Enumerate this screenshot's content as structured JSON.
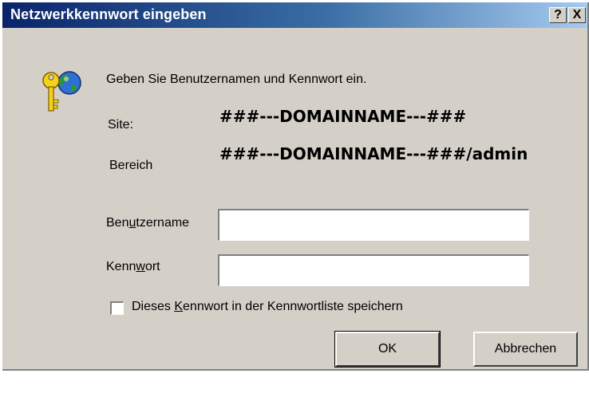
{
  "window": {
    "title": "Netzwerkkennwort eingeben",
    "help_button": "?",
    "close_button": "X"
  },
  "icon": "key-globe-icon",
  "prompt": "Geben Sie Benutzernamen und Kennwort ein.",
  "site": {
    "label": "Site:",
    "value": "###---DOMAINNAME---###"
  },
  "bereich": {
    "label": "Bereich",
    "value": "###---DOMAINNAME---###/admin"
  },
  "username": {
    "label_pre": "Ben",
    "label_key": "u",
    "label_post": "tzername",
    "value": ""
  },
  "password": {
    "label_pre": "Kenn",
    "label_key": "w",
    "label_post": "ort",
    "value": ""
  },
  "save_password": {
    "label_pre": "Dieses ",
    "label_key": "K",
    "label_post": "ennwort in der Kennwortliste speichern",
    "checked": false
  },
  "buttons": {
    "ok": "OK",
    "cancel": "Abbrechen"
  }
}
